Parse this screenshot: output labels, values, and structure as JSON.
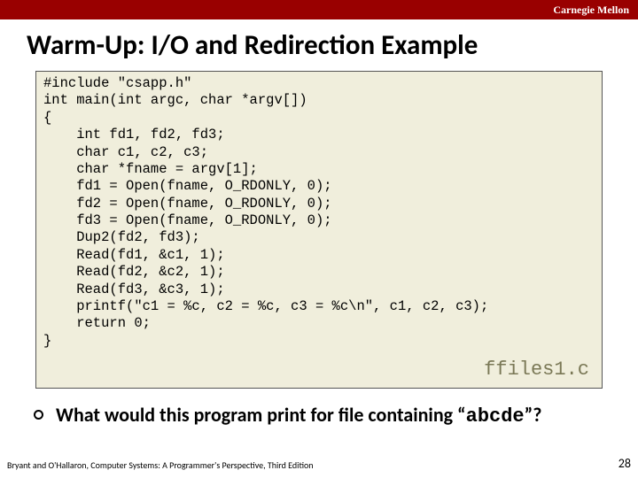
{
  "header": {
    "institution": "Carnegie Mellon"
  },
  "title": "Warm-Up: I/O and Redirection Example",
  "code": "#include \"csapp.h\"\nint main(int argc, char *argv[])\n{\n    int fd1, fd2, fd3;\n    char c1, c2, c3;\n    char *fname = argv[1];\n    fd1 = Open(fname, O_RDONLY, 0);\n    fd2 = Open(fname, O_RDONLY, 0);\n    fd3 = Open(fname, O_RDONLY, 0);\n    Dup2(fd2, fd3);\n    Read(fd1, &c1, 1);\n    Read(fd2, &c2, 1);\n    Read(fd3, &c3, 1);\n    printf(\"c1 = %c, c2 = %c, c3 = %c\\n\", c1, c2, c3);\n    return 0;\n}",
  "code_filename": "ffiles1.c",
  "question": {
    "prefix": "What would this program print for file containing “",
    "mono": "abcde",
    "suffix": "”?"
  },
  "footer": {
    "citation": "Bryant and O'Hallaron, Computer Systems: A Programmer's Perspective, Third Edition",
    "page": "28"
  }
}
